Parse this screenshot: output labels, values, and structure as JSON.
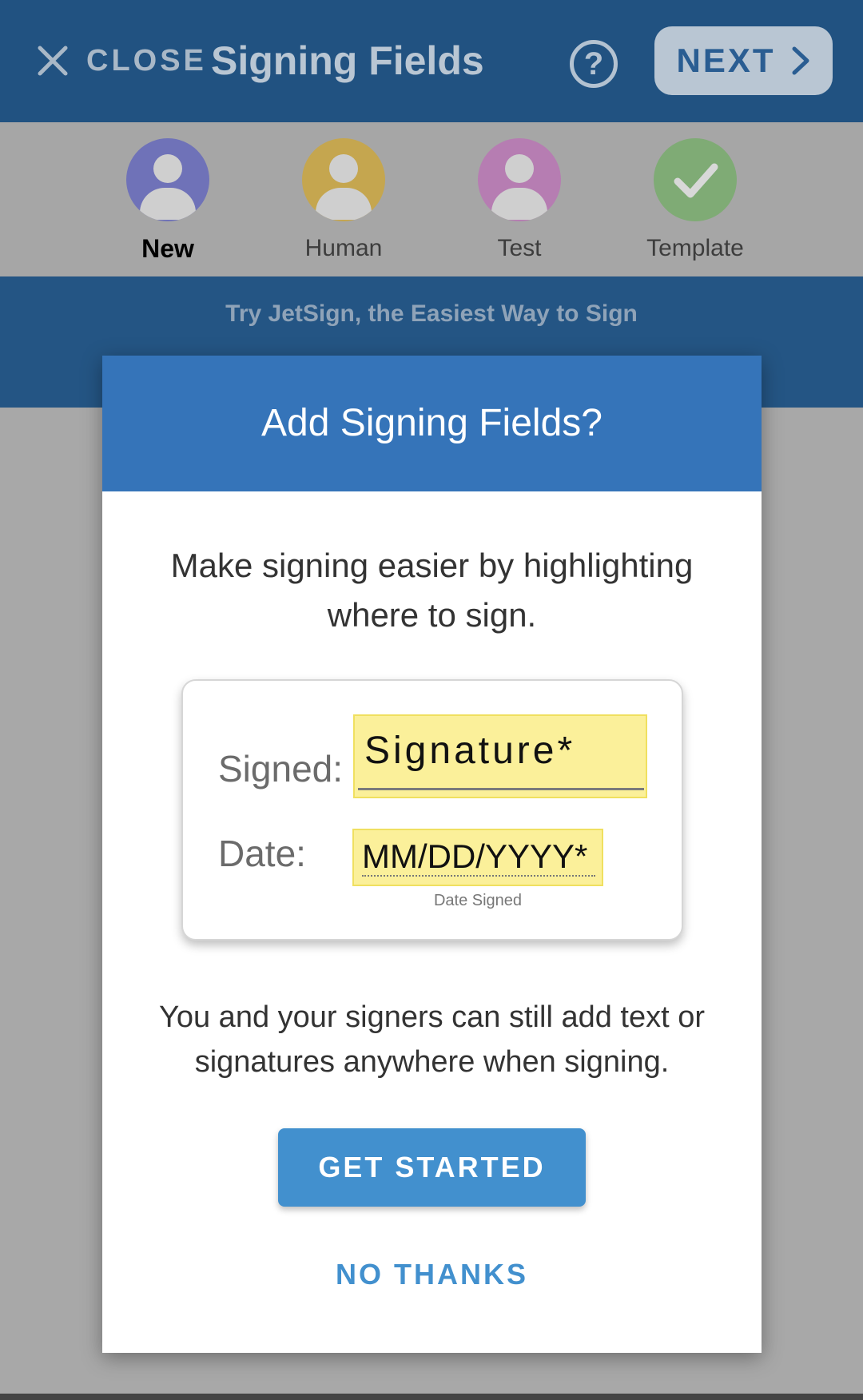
{
  "header": {
    "close_label": "CLOSE",
    "title": "Signing Fields",
    "help_symbol": "?",
    "next_label": "NEXT"
  },
  "signers": [
    {
      "label": "New",
      "color": "#6f72b8",
      "active": true,
      "icon": "person-icon"
    },
    {
      "label": "Human",
      "color": "#c5a64f",
      "active": false,
      "icon": "person-icon"
    },
    {
      "label": "Test",
      "color": "#b67db2",
      "active": false,
      "icon": "person-icon"
    },
    {
      "label": "Template",
      "color": "#7fab75",
      "active": false,
      "icon": "checkmark-icon"
    }
  ],
  "banner": {
    "text": "Try JetSign, the Easiest Way to Sign"
  },
  "modal": {
    "title": "Add Signing Fields?",
    "lead": "Make signing easier by highlighting where to sign.",
    "preview": {
      "signed_label": "Signed:",
      "signature_placeholder": "Signature*",
      "date_label": "Date:",
      "date_placeholder": "MM/DD/YYYY*",
      "date_caption": "Date Signed"
    },
    "note": "You and your signers can still add text or signatures anywhere when signing.",
    "get_started_label": "GET STARTED",
    "no_thanks_label": "NO THANKS"
  },
  "colors": {
    "header_bg": "#215281",
    "modal_header_bg": "#3574b9",
    "primary_button": "#4290ce",
    "field_highlight": "#fbf09a"
  }
}
